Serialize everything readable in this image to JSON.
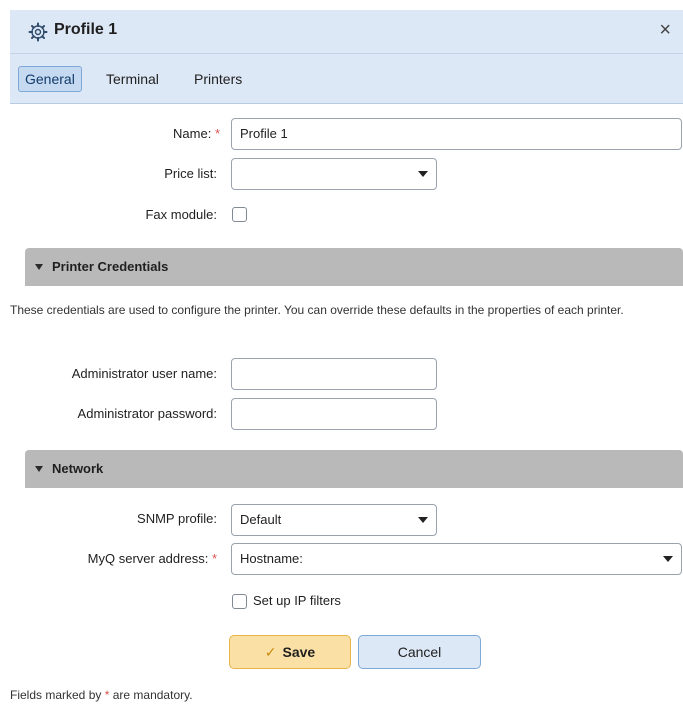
{
  "dialog": {
    "title": "Profile 1",
    "title_icon": "gear-icon",
    "close_label": "×"
  },
  "tabs": [
    {
      "label": "General",
      "active": true
    },
    {
      "label": "Terminal",
      "active": false
    },
    {
      "label": "Printers",
      "active": false
    }
  ],
  "general": {
    "name_label": "Name:",
    "name_value": "Profile 1",
    "price_list_label": "Price list:",
    "price_list_value": "",
    "fax_module_label": "Fax module:",
    "fax_module_checked": false
  },
  "printer_credentials": {
    "title": "Printer Credentials",
    "description": "These credentials are used to configure the printer. You can override these defaults in the properties of each printer.",
    "admin_user_label": "Administrator user name:",
    "admin_user_value": "",
    "admin_password_label": "Administrator password:",
    "admin_password_value": ""
  },
  "network": {
    "title": "Network",
    "snmp_profile_label": "SNMP profile:",
    "snmp_profile_value": "Default",
    "server_address_label": "MyQ server address:",
    "server_address_value": "Hostname:",
    "ip_filters_label": "Set up IP filters",
    "ip_filters_checked": false
  },
  "actions": {
    "save_label": "Save",
    "cancel_label": "Cancel"
  },
  "footer": {
    "prefix": "Fields marked by",
    "star": "*",
    "suffix": "are mandatory."
  },
  "colors": {
    "header_bg": "#dde8f6",
    "section_bg": "#b9b9b9",
    "required": "#d9534f",
    "save_bg": "#fbe0a5"
  }
}
